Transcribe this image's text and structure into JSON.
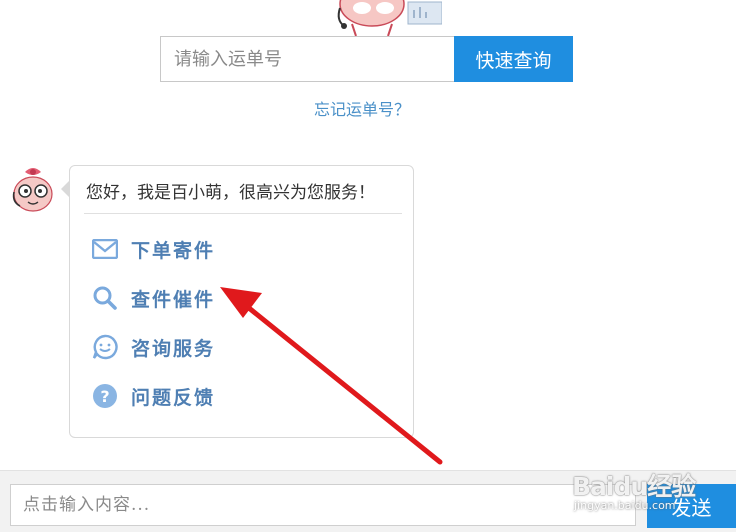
{
  "search": {
    "placeholder": "请输入运单号",
    "button_label": "快速查询",
    "forgot_link": "忘记运单号？"
  },
  "chat": {
    "greeting": "您好，我是百小萌，很高兴为您服务！",
    "menu": [
      {
        "label": "下单寄件",
        "icon": "envelope-icon"
      },
      {
        "label": "查件催件",
        "icon": "search-icon"
      },
      {
        "label": "咨询服务",
        "icon": "smile-chat-icon"
      },
      {
        "label": "问题反馈",
        "icon": "question-icon"
      }
    ]
  },
  "composer": {
    "placeholder": "点击输入内容...",
    "send_label": "发送"
  },
  "watermark": {
    "brand": "Baidu经验",
    "url": "jingyan.baidu.com"
  },
  "colors": {
    "accent": "#1f8ee0",
    "menu_text": "#4f7fb3",
    "icon": "#7aa9dd",
    "arrow": "#e0191c"
  }
}
